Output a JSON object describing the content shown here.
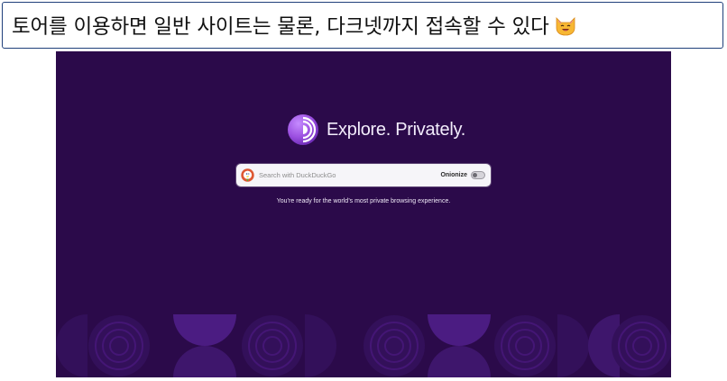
{
  "caption": {
    "text": "토어를 이용하면 일반 사이트는 물론, 다크넷까지 접속할 수 있다",
    "emoji": "smiling-cat-icon"
  },
  "browser": {
    "tagline": "Explore. Privately.",
    "search": {
      "engine_icon": "duckduckgo-icon",
      "placeholder": "Search with DuckDuckGo",
      "value": ""
    },
    "onionize": {
      "label": "Onionize",
      "enabled": false
    },
    "subtitle": "You’re ready for the world’s most private browsing experience.",
    "logo": "tor-browser-logo-icon"
  },
  "colors": {
    "background": "#2b0a4a",
    "pattern_dark": "#33105a",
    "pattern_mid": "#3e166c",
    "pattern_light": "#4b1c82",
    "logo_purple": "#9b4fe0",
    "caption_border": "#1f3f7a"
  }
}
